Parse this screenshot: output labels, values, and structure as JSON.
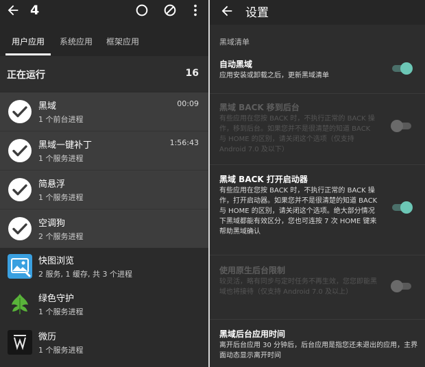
{
  "left": {
    "header": {
      "count": "4"
    },
    "tabs": [
      {
        "label": "用户应用"
      },
      {
        "label": "系统应用"
      },
      {
        "label": "框架应用"
      }
    ],
    "running": {
      "label": "正在运行",
      "count": "16"
    },
    "apps": [
      {
        "name": "黑域",
        "detail": "1 个前台进程",
        "time": "00:09",
        "icon": "check-circle-icon"
      },
      {
        "name": "黑域一键补丁",
        "detail": "1 个服务进程",
        "time": "1:56:43",
        "icon": "check-circle-icon"
      },
      {
        "name": "简悬浮",
        "detail": "1 个服务进程",
        "icon": "check-circle-icon"
      },
      {
        "name": "空调狗",
        "detail": "2 个服务进程",
        "icon": "check-circle-icon"
      },
      {
        "name": "快图浏览",
        "detail": "2 服务, 1 缓存, 共 3 个进程",
        "icon": "photo-viewer-icon"
      },
      {
        "name": "绿色守护",
        "detail": "1 个服务进程",
        "icon": "green-leaf-icon"
      },
      {
        "name": "微历",
        "detail": "1 个服务进程",
        "icon": "calendar-w-icon"
      }
    ]
  },
  "right": {
    "header": {
      "title": "设置"
    },
    "section": "黑域清单",
    "prefs": [
      {
        "title": "自动黑域",
        "desc": "应用安装或卸载之后，更新黑域清单",
        "enabled": true,
        "checked": true
      },
      {
        "title": "黑域 BACK 移到后台",
        "desc": "有些应用在您按 BACK 时，不执行正常的 BACK 操作，移到后台。如果您并不是很清楚的知道 BACK 与 HOME 的区别，请关闭这个选项（仅支持 Android 7.0 及以下）",
        "enabled": false,
        "checked": false
      },
      {
        "title": "黑域 BACK 打开启动器",
        "desc": "有些应用在您按 BACK 时，不执行正常的 BACK 操作，打开启动器。如果您并不是很清楚的知道 BACK 与 HOME 的区别，请关闭这个选项。绝大部分情况下黑域都能有效区分，您也可连按 7 次 HOME 键来帮助黑域确认",
        "enabled": true,
        "checked": true
      },
      {
        "title": "使用原生后台限制",
        "desc": "较灵活，略有同步与定时任务不再生效，您您即能黑域也将接待（仅支持 Android 7.0 及以上）",
        "enabled": false,
        "checked": false
      },
      {
        "title": "黑域后台应用时间",
        "desc": "离开后台应用 30 分钟后，后台应用是指您还未退出的应用，主界面动态显示离开时间"
      }
    ]
  },
  "colors": {
    "accent": "#6cc7b6",
    "selected_row": "#3d3d3d"
  }
}
